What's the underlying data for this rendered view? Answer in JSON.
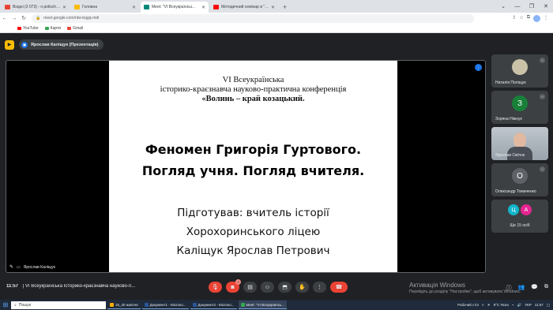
{
  "browser": {
    "tabs": [
      {
        "label": "Вхідні (2 073) - n.polischuk@...",
        "color": "#ea4335",
        "active": false
      },
      {
        "label": "Головна",
        "color": "#fbbc04",
        "active": false
      },
      {
        "label": "Meet: \"VI Всеукраїнсьі...",
        "color": "#00897b",
        "active": true
      },
      {
        "label": "Методичний семінар в \"Культ...",
        "color": "#ff0000",
        "active": false
      }
    ],
    "url": "meet.google.com/ntw-bqgq-mdi",
    "bookmarks": [
      {
        "label": "YouTube",
        "color": "#ff0000"
      },
      {
        "label": "Карти",
        "color": "#34a853"
      },
      {
        "label": "Gmail",
        "color": "#ea4335"
      }
    ]
  },
  "meet": {
    "presenter": "Ярослав Каліщук (Презентація)",
    "slide": {
      "line1": "VI Всеукраїнська",
      "line2": "історико-краєзнавча науково-практична конференція",
      "line3": "«Волинь – край козацький.",
      "title1": "Феномен Григорія Гуртового.",
      "title2": "Погляд учня. Погляд вчителя.",
      "sub1": "Підготував: вчитель історії",
      "sub2": "Хорохоринського ліцею",
      "sub3": "Каліщук Ярослав Петрович"
    },
    "stage_name": "Ярослав Каліщук",
    "participants": [
      {
        "name": "Наталія Поліщук",
        "initial": "",
        "color": "#c9c2a8"
      },
      {
        "name": "Зоряна Ніжнук",
        "initial": "З",
        "color": "#188038"
      },
      {
        "name": "Ярослав Світюк",
        "initial": "",
        "color": "#9aa3ab"
      },
      {
        "name": "Олександр Томаченко",
        "initial": "О",
        "color": "#5f6368"
      }
    ],
    "others": {
      "label": "Ще 15 осіб",
      "initials": [
        "Ц",
        "А"
      ],
      "colors": [
        "#12b5cb",
        "#e52592"
      ]
    },
    "time": "11:57",
    "meeting_title": "VI Всеукраїнська Історико-краєзнавча науково-п...",
    "hand_badge": "2",
    "activation_title": "Активація Windows",
    "activation_text": "Перейдіть до розділу \"Настройки\", щоб активувати Windows."
  },
  "taskbar": {
    "search_placeholder": "Пошук",
    "apps": [
      {
        "label": "15_20 жовтня",
        "color": "#f9ab00",
        "active": false
      },
      {
        "label": "Документ1 - Microso...",
        "color": "#2b579a",
        "active": false
      },
      {
        "label": "Документ2 - Microso...",
        "color": "#2b579a",
        "active": false
      },
      {
        "label": "Meet: \"VI Всеукраїнсь...",
        "color": "#34a853",
        "active": true
      }
    ],
    "weather": "9°C Ясно",
    "keyboard": "УКР",
    "clock": "11:57",
    "desktop_label": "Робочий стіл"
  }
}
